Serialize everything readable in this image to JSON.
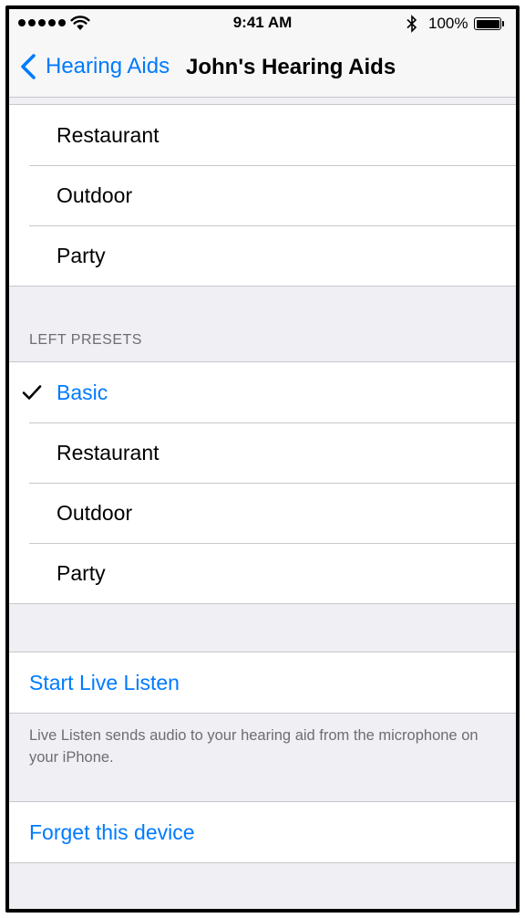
{
  "status_bar": {
    "time": "9:41 AM",
    "battery_percent": "100%",
    "signal_icon": "cellular-signal-icon",
    "wifi_icon": "wifi-icon",
    "bluetooth_icon": "bluetooth-icon",
    "battery_icon": "battery-icon"
  },
  "nav": {
    "back_label": "Hearing Aids",
    "title": "John's Hearing Aids"
  },
  "right_presets": {
    "items": [
      "Restaurant",
      "Outdoor",
      "Party"
    ]
  },
  "left_presets": {
    "header": "LEFT PRESETS",
    "selected": "Basic",
    "items": [
      "Basic",
      "Restaurant",
      "Outdoor",
      "Party"
    ]
  },
  "live_listen": {
    "label": "Start Live Listen",
    "footer": "Live Listen sends audio to your hearing aid from the microphone on your iPhone."
  },
  "forget": {
    "label": "Forget this device"
  },
  "colors": {
    "accent": "#007aff",
    "background": "#efeff4",
    "separator": "#c8c7cc",
    "secondary_text": "#6d6d72"
  }
}
